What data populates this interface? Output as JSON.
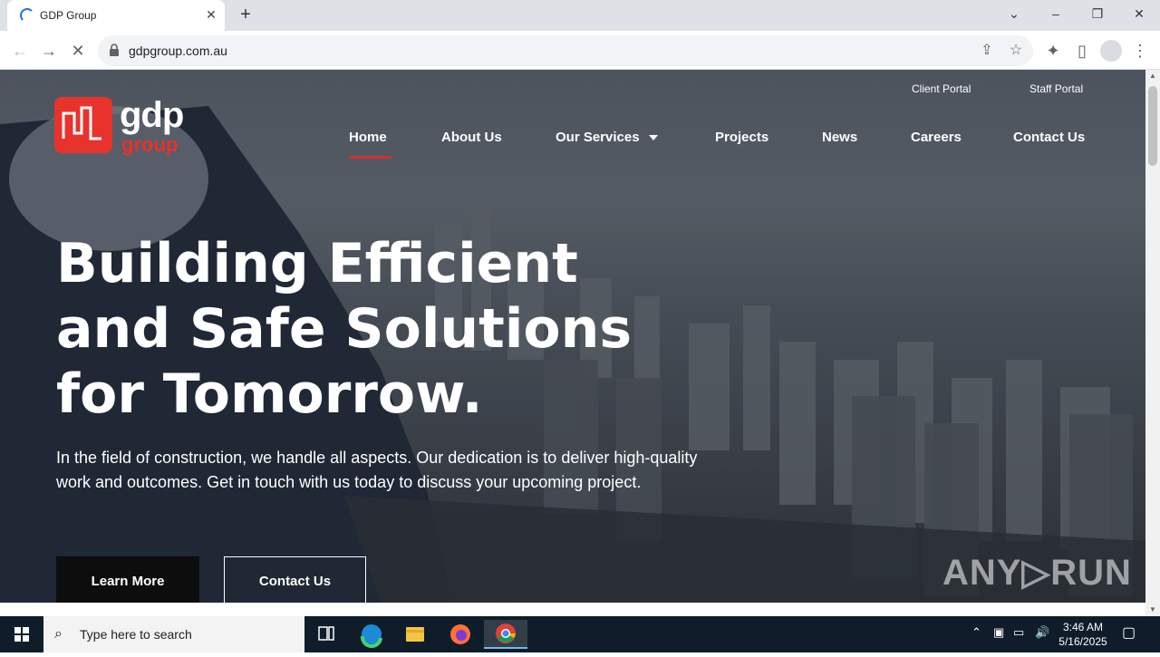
{
  "browser": {
    "tab_title": "GDP Group",
    "url": "gdpgroup.com.au"
  },
  "header": {
    "portals": [
      "Client Portal",
      "Staff Portal"
    ],
    "logo_text": "gdp",
    "logo_sub": "group",
    "nav": [
      {
        "label": "Home",
        "active": true
      },
      {
        "label": "About Us"
      },
      {
        "label": "Our Services",
        "dropdown": true
      },
      {
        "label": "Projects"
      },
      {
        "label": "News"
      },
      {
        "label": "Careers"
      },
      {
        "label": "Contact Us"
      }
    ]
  },
  "hero": {
    "headline_lines": [
      "Building Efficient",
      "and Safe Solutions",
      "for Tomorrow."
    ],
    "subtext": "In the field of construction, we handle all aspects. Our dedication is to deliver high-quality work and outcomes. Get in touch with us today to discuss your upcoming project.",
    "primary_button": "Learn More",
    "secondary_button": "Contact Us"
  },
  "watermark": "ANY▷RUN",
  "taskbar": {
    "search_placeholder": "Type here to search",
    "time": "3:46 AM",
    "date": "5/16/2025"
  },
  "colors": {
    "accent": "#e8322c",
    "nav_underline": "#d32f2f"
  }
}
